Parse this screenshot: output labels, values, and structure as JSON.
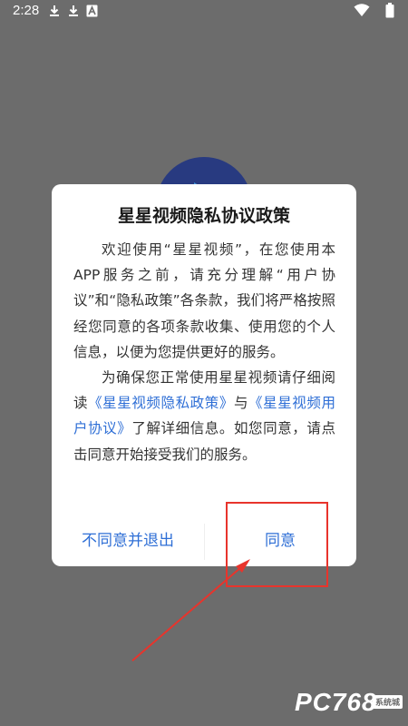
{
  "status_bar": {
    "time": "2:28",
    "icons": [
      "download-icon",
      "download-icon",
      "font-icon",
      "wifi-icon",
      "battery-icon"
    ]
  },
  "dialog": {
    "title": "星星视频隐私协议政策",
    "paragraph1": "欢迎使用“星星视频”，在您使用本APP服务之前，请充分理解“用户协议”和“隐私政策”各条款，我们将严格按照经您同意的各项条款收集、使用您的个人信息，以便为您提供更好的服务。",
    "paragraph2": {
      "prefix": "为确保您正常使用星星视频请仔细阅读",
      "privacy_link": "《星星视频隐私政策》",
      "middle": "与",
      "agreement_link": "《星星视频用户协议》",
      "suffix": "了解详细信息。如您同意，请点击同意开始接受我们的服务。"
    },
    "decline_label": "不同意并退出",
    "agree_label": "同意"
  },
  "watermark": {
    "text": "PC768",
    "badge": "系统城"
  },
  "colors": {
    "overlay": "#6c6c6c",
    "accent": "#2f6fd6",
    "annotation": "#e8342c",
    "logo": "#283a80"
  }
}
